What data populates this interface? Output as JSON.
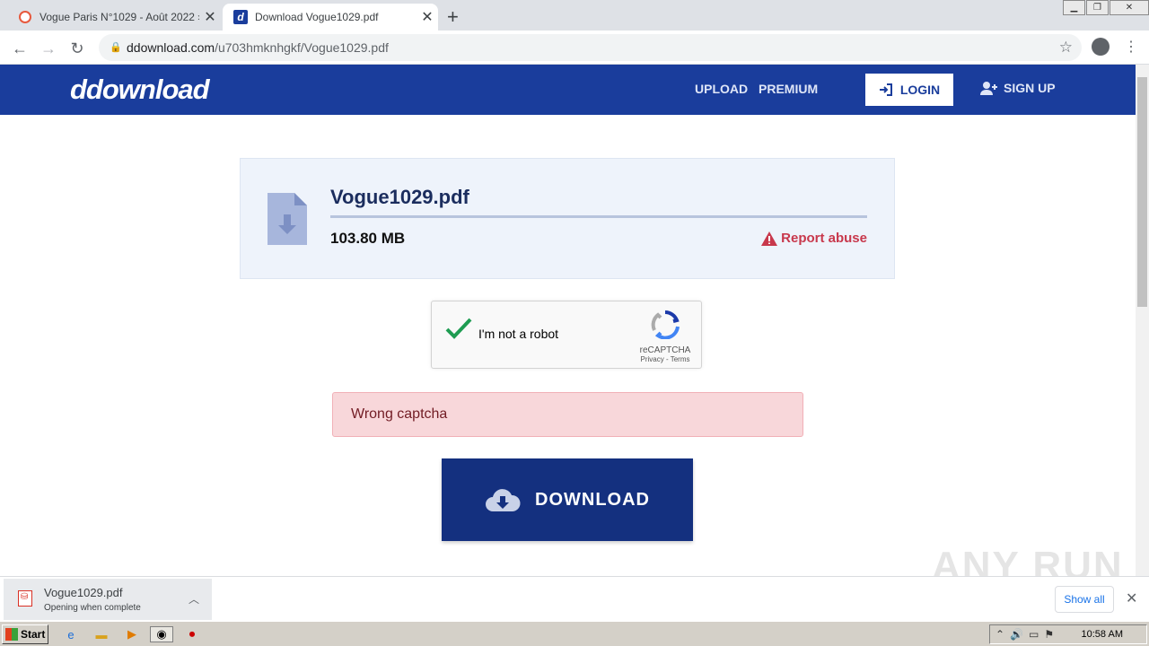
{
  "browser": {
    "tabs": [
      {
        "title": "Vogue Paris N°1029 - Août 2022 » To",
        "favicon": "vogue-favicon"
      },
      {
        "title": "Download Vogue1029.pdf",
        "favicon": "ddownload-favicon",
        "active": true
      }
    ],
    "url_host": "ddownload.com",
    "url_path": "/u703hmknhgkf/Vogue1029.pdf"
  },
  "site": {
    "logo": "ddownload",
    "nav": {
      "upload": "UPLOAD",
      "premium": "PREMIUM",
      "login": "LOGIN",
      "signup": "SIGN UP"
    },
    "brand_color": "#1a3d9c"
  },
  "file": {
    "name": "Vogue1029.pdf",
    "size": "103.80 MB",
    "report": "Report abuse"
  },
  "captcha": {
    "label": "I'm not a robot",
    "brand": "reCAPTCHA",
    "links": "Privacy - Terms",
    "checked": true
  },
  "alert": {
    "message": "Wrong captcha"
  },
  "download_button": {
    "label": "DOWNLOAD"
  },
  "download_shelf": {
    "filename": "Vogue1029.pdf",
    "status": "Opening when complete",
    "show_all": "Show all"
  },
  "watermark": "ANY RUN",
  "taskbar": {
    "start": "Start",
    "time": "10:58 AM"
  }
}
